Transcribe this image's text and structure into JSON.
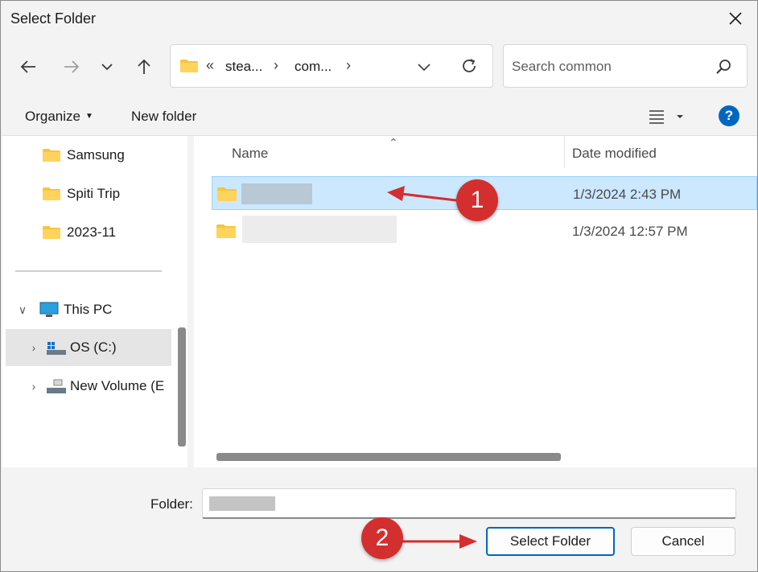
{
  "window": {
    "title": "Select Folder"
  },
  "nav": {
    "back_icon": "arrow-left-icon",
    "forward_icon": "arrow-right-icon",
    "recent_icon": "chevron-down-icon",
    "up_icon": "arrow-up-icon"
  },
  "address": {
    "overflow": "«",
    "crumbs": [
      "stea...",
      "com..."
    ]
  },
  "search": {
    "placeholder": "Search common"
  },
  "toolbar": {
    "organize_label": "Organize",
    "new_folder_label": "New folder"
  },
  "sidebar": {
    "quick_items": [
      {
        "label": "Samsung"
      },
      {
        "label": "Spiti Trip"
      },
      {
        "label": "2023-11"
      }
    ],
    "this_pc_label": "This PC",
    "drives": [
      {
        "label": "OS (C:)"
      },
      {
        "label": "New Volume (E"
      }
    ]
  },
  "filelist": {
    "columns": {
      "name": "Name",
      "date": "Date modified"
    },
    "rows": [
      {
        "date": "1/3/2024 2:43 PM",
        "selected": true
      },
      {
        "date": "1/3/2024 12:57 PM",
        "selected": false
      }
    ]
  },
  "footer": {
    "folder_label": "Folder:",
    "select_label": "Select Folder",
    "cancel_label": "Cancel"
  },
  "annotations": {
    "step1": "1",
    "step2": "2"
  },
  "colors": {
    "accent": "#0067c0",
    "selection": "#cce8ff",
    "annotation": "#d32f2f"
  }
}
